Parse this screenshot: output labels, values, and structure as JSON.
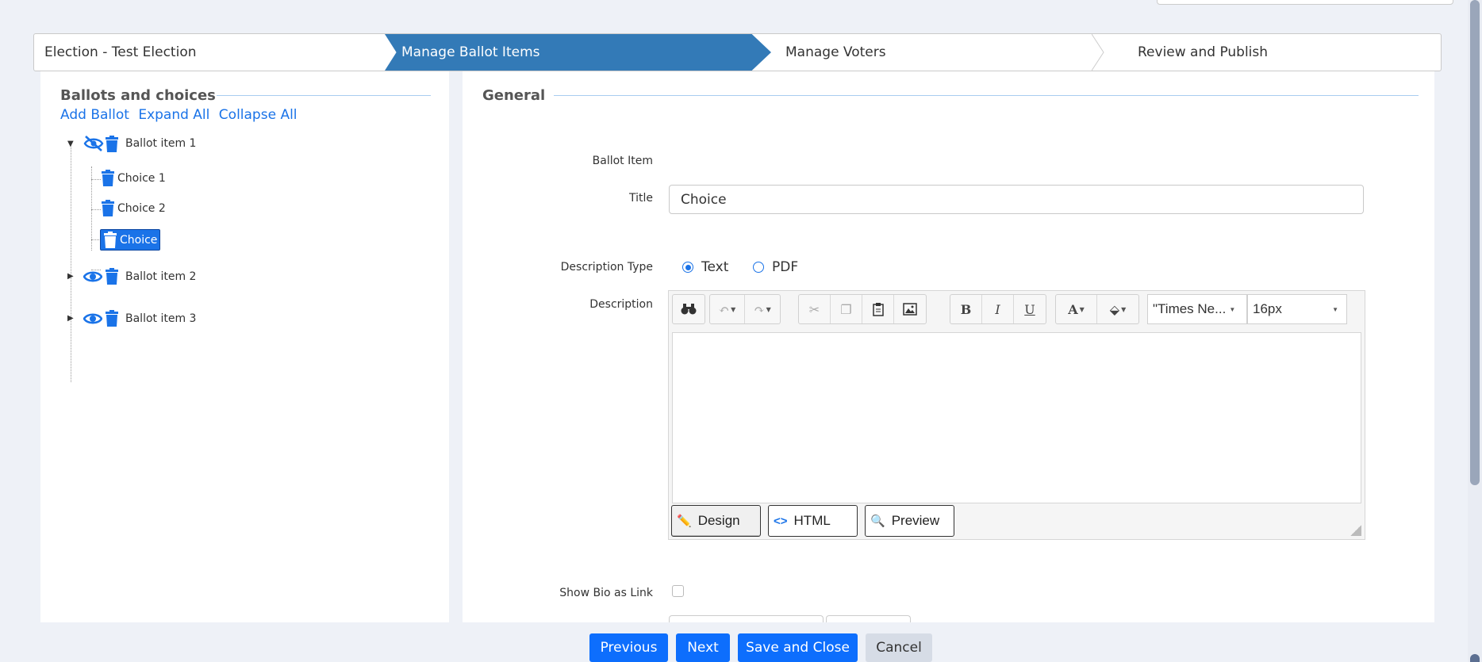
{
  "wizard": {
    "steps": [
      {
        "label": "Election - Test Election"
      },
      {
        "label": "Manage Ballot Items"
      },
      {
        "label": "Manage Voters"
      },
      {
        "label": "Review and Publish"
      }
    ],
    "active_index": 1
  },
  "ballots_panel": {
    "title": "Ballots and choices",
    "links": {
      "add": "Add Ballot",
      "expand": "Expand All",
      "collapse": "Collapse All"
    },
    "tree": [
      {
        "label": "Ballot item 1",
        "expanded": true,
        "visibility_icon": "eye-slash-icon",
        "children": [
          {
            "label": "Choice 1"
          },
          {
            "label": "Choice 2"
          },
          {
            "label": "Choice",
            "selected": true
          }
        ]
      },
      {
        "label": "Ballot item 2",
        "expanded": false,
        "visibility_icon": "eye-icon"
      },
      {
        "label": "Ballot item 3",
        "expanded": false,
        "visibility_icon": "eye-icon"
      }
    ]
  },
  "general": {
    "title": "General",
    "ballot_item_label": "Ballot Item",
    "title_label": "Title",
    "title_value": "Choice",
    "description_type_label": "Description Type",
    "description_types": [
      {
        "label": "Text",
        "checked": true
      },
      {
        "label": "PDF",
        "checked": false
      }
    ],
    "description_label": "Description",
    "editor": {
      "font_name": "\"Times Ne...",
      "font_size": "16px",
      "modes": [
        {
          "label": "Design",
          "icon": "pencil-icon"
        },
        {
          "label": "HTML",
          "icon": "code-icon"
        },
        {
          "label": "Preview",
          "icon": "magnifier-icon"
        }
      ],
      "toolbar_icons": [
        "binoculars-icon",
        "undo-icon",
        "redo-icon",
        "cut-icon",
        "copy-icon",
        "paste-icon",
        "image-icon",
        "bold-icon",
        "italic-icon",
        "underline-icon",
        "font-color-icon",
        "back-color-icon"
      ]
    },
    "show_bio_label": "Show Bio as Link"
  },
  "footer": {
    "previous": "Previous",
    "next": "Next",
    "save_close": "Save and Close",
    "cancel": "Cancel"
  },
  "colors": {
    "accent": "#1a73e8",
    "step_active": "#337ab7",
    "primary_button": "#0d6efd"
  }
}
